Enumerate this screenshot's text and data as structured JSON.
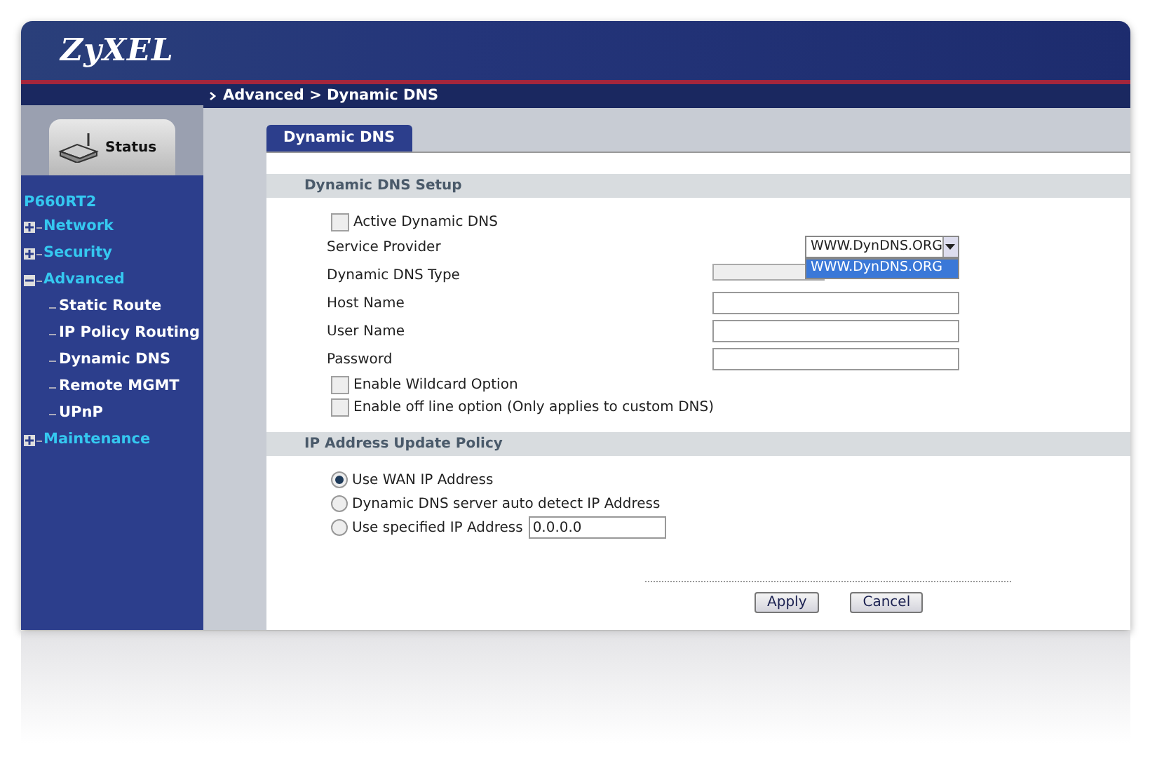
{
  "header": {
    "logo": "ZyXEL"
  },
  "breadcrumb": "Advanced > Dynamic DNS",
  "status_tab": {
    "label": "Status"
  },
  "sidebar": {
    "device": "P660RT2",
    "items": [
      {
        "label": "Network",
        "expanded": false
      },
      {
        "label": "Security",
        "expanded": false
      },
      {
        "label": "Advanced",
        "expanded": true,
        "children": [
          {
            "label": "Static Route"
          },
          {
            "label": "IP Policy Routing"
          },
          {
            "label": "Dynamic DNS"
          },
          {
            "label": "Remote MGMT"
          },
          {
            "label": "UPnP"
          }
        ]
      },
      {
        "label": "Maintenance",
        "expanded": false
      }
    ]
  },
  "tabs": [
    {
      "label": "Dynamic DNS",
      "selected": true
    }
  ],
  "setup": {
    "title": "Dynamic DNS Setup",
    "active": {
      "label": "Active Dynamic DNS",
      "checked": false
    },
    "fields": [
      {
        "kind": "dropdown",
        "label": "Service Provider",
        "value": "WWW.DynDNS.ORG",
        "expanded": true,
        "options": [
          {
            "label": "WWW.DynDNS.ORG",
            "selected": true
          }
        ]
      },
      {
        "kind": "covered",
        "label": "Dynamic DNS Type"
      },
      {
        "kind": "text",
        "label": "Host Name"
      },
      {
        "kind": "text",
        "label": "User Name"
      },
      {
        "kind": "text",
        "label": "Password"
      }
    ],
    "options": [
      {
        "label": "Enable Wildcard Option",
        "checked": false
      },
      {
        "label": "Enable off line option (Only applies to custom DNS)",
        "checked": false
      }
    ]
  },
  "policy": {
    "title": "IP Address Update Policy",
    "choices": [
      {
        "label": "Use WAN IP Address",
        "selected": true
      },
      {
        "label": "Dynamic DNS server auto detect IP Address",
        "selected": false
      },
      {
        "label": "Use specified IP Address",
        "selected": false,
        "value": "0.0.0.0"
      }
    ]
  },
  "buttons": [
    "Apply",
    "Cancel"
  ]
}
